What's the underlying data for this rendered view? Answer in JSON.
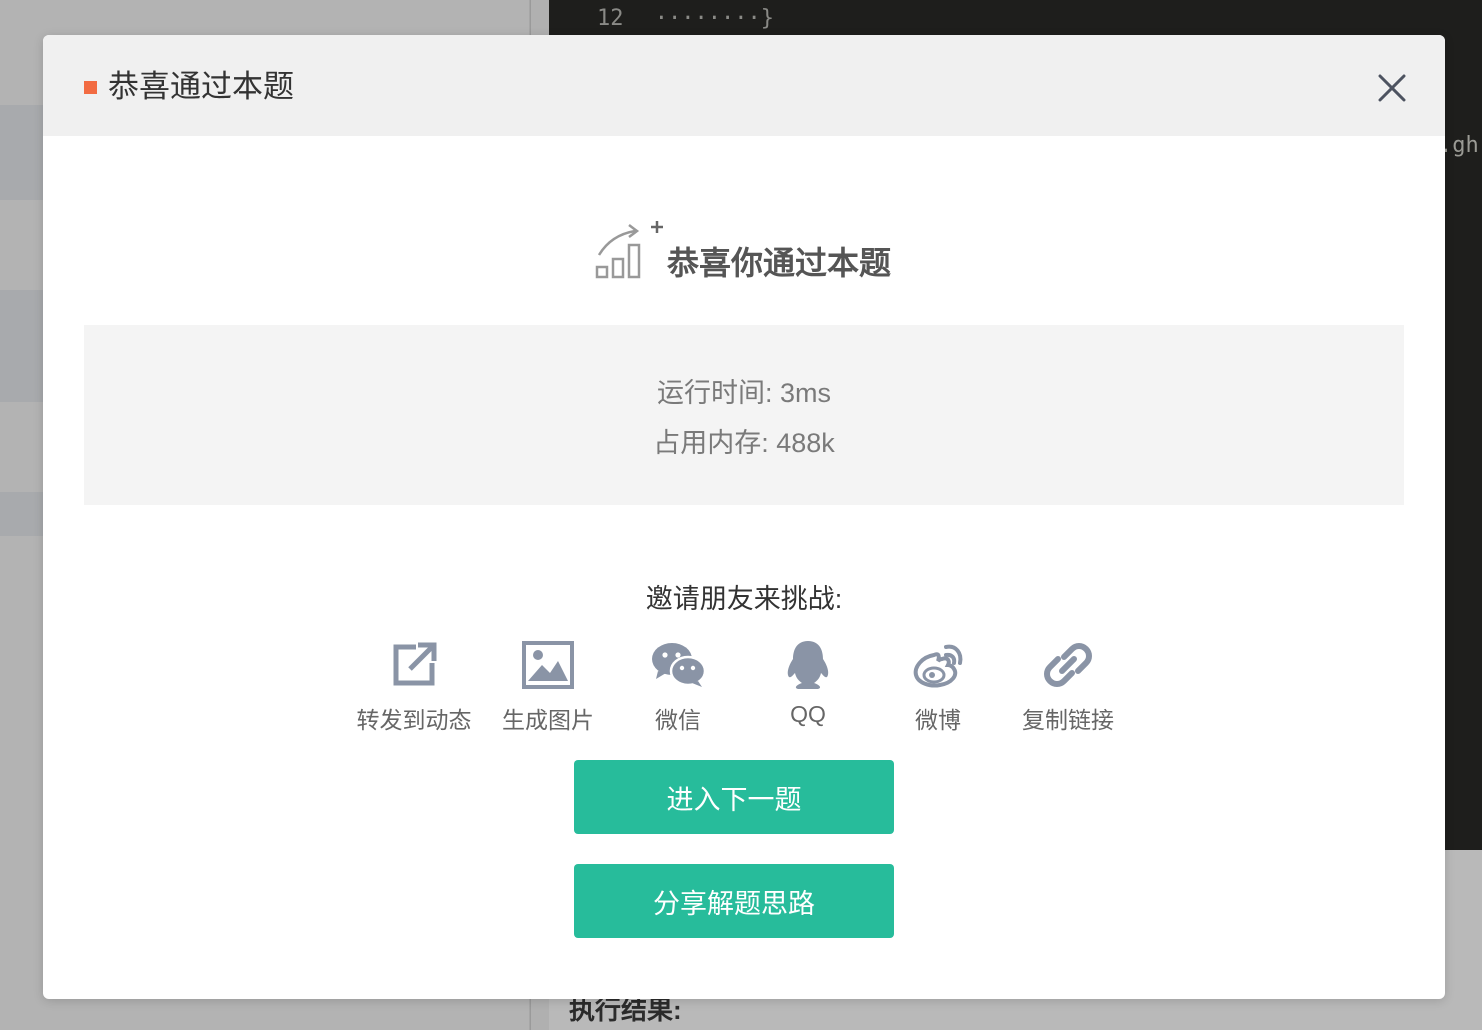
{
  "background": {
    "editor_line_number": "12",
    "editor_line_code": "········}",
    "editor_fragment": ".gh",
    "console_label": "执行结果:"
  },
  "modal": {
    "title": "恭喜通过本题",
    "success_message": "恭喜你通过本题",
    "stats": {
      "runtime": "运行时间: 3ms",
      "memory": "占用内存: 488k"
    },
    "invite_title": "邀请朋友来挑战:",
    "share_options": [
      {
        "label": "转发到动态",
        "icon": "external-share-icon"
      },
      {
        "label": "生成图片",
        "icon": "image-icon"
      },
      {
        "label": "微信",
        "icon": "wechat-icon"
      },
      {
        "label": "QQ",
        "icon": "qq-icon"
      },
      {
        "label": "微博",
        "icon": "weibo-icon"
      },
      {
        "label": "复制链接",
        "icon": "link-icon"
      }
    ],
    "next_button": "进入下一题",
    "share_solution_button": "分享解题思路"
  },
  "colors": {
    "accent_green": "#27bc9b",
    "header_marker": "#f26b42",
    "icon_gray": "#8a94a6"
  }
}
